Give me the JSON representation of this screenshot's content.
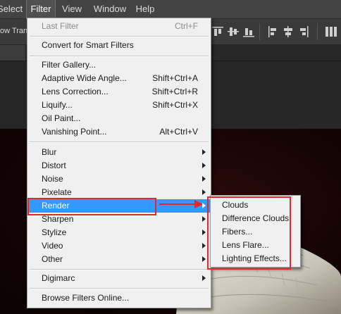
{
  "menubar": {
    "items": [
      {
        "label": "Select",
        "active": false
      },
      {
        "label": "Filter",
        "active": true
      },
      {
        "label": "View",
        "active": false
      },
      {
        "label": "Window",
        "active": false
      },
      {
        "label": "Help",
        "active": false
      }
    ]
  },
  "options_bar": {
    "partial_label": "ow Trans"
  },
  "filter_menu": {
    "last_filter": {
      "label": "Last Filter",
      "shortcut": "Ctrl+F"
    },
    "convert_smart": {
      "label": "Convert for Smart Filters"
    },
    "filter_gallery": {
      "label": "Filter Gallery..."
    },
    "adaptive_wide_angle": {
      "label": "Adaptive Wide Angle...",
      "shortcut": "Shift+Ctrl+A"
    },
    "lens_correction": {
      "label": "Lens Correction...",
      "shortcut": "Shift+Ctrl+R"
    },
    "liquify": {
      "label": "Liquify...",
      "shortcut": "Shift+Ctrl+X"
    },
    "oil_paint": {
      "label": "Oil Paint..."
    },
    "vanishing_point": {
      "label": "Vanishing Point...",
      "shortcut": "Alt+Ctrl+V"
    },
    "blur": {
      "label": "Blur"
    },
    "distort": {
      "label": "Distort"
    },
    "noise": {
      "label": "Noise"
    },
    "pixelate": {
      "label": "Pixelate"
    },
    "render": {
      "label": "Render"
    },
    "sharpen": {
      "label": "Sharpen"
    },
    "stylize": {
      "label": "Stylize"
    },
    "video": {
      "label": "Video"
    },
    "other": {
      "label": "Other"
    },
    "digimarc": {
      "label": "Digimarc"
    },
    "browse_online": {
      "label": "Browse Filters Online..."
    }
  },
  "render_submenu": {
    "items": [
      {
        "label": "Clouds"
      },
      {
        "label": "Difference Clouds"
      },
      {
        "label": "Fibers..."
      },
      {
        "label": "Lens Flare..."
      },
      {
        "label": "Lighting Effects..."
      }
    ]
  },
  "colors": {
    "highlight": "#3399ff",
    "annotation_red": "#e0282d",
    "menubar_bg": "#434343"
  }
}
